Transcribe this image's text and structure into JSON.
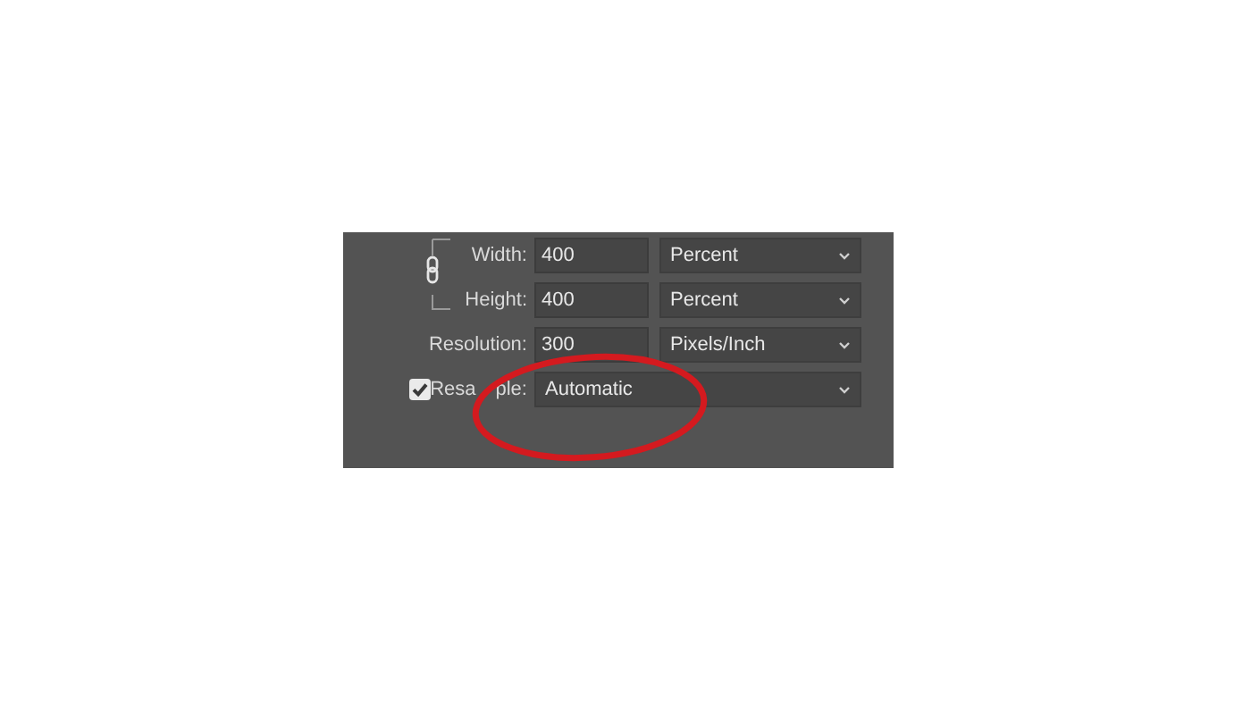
{
  "fields": [
    {
      "label": "Width:",
      "value": "400",
      "unit": "Percent"
    },
    {
      "label": "Height:",
      "value": "400",
      "unit": "Percent"
    },
    {
      "label": "Resolution:",
      "value": "300",
      "unit": "Pixels/Inch"
    }
  ],
  "constrain_proportions": {
    "on": true
  },
  "resample": {
    "label_parts": [
      "Resa",
      "ple:"
    ],
    "checked": true,
    "value": "Automatic"
  },
  "annotation": {
    "kind": "ellipse",
    "color": "#d41a1f"
  }
}
